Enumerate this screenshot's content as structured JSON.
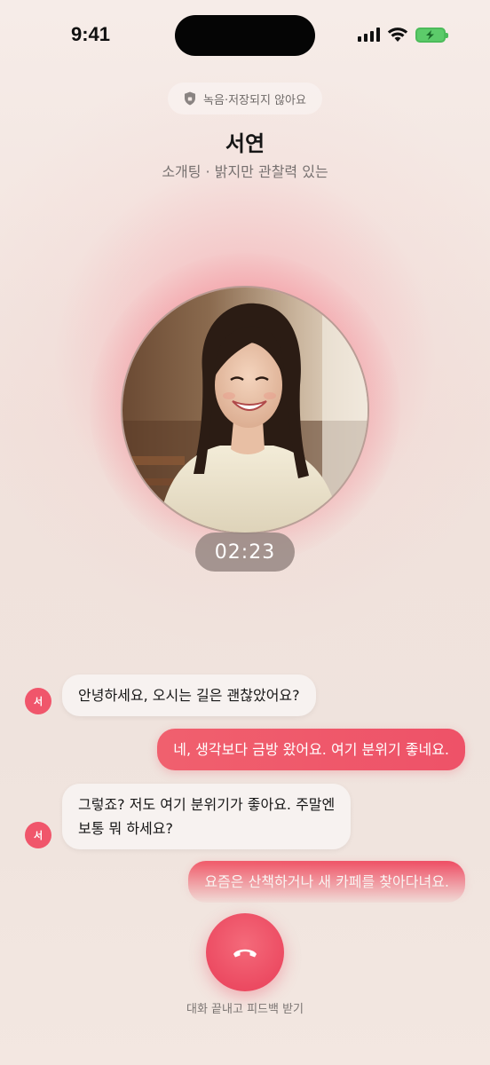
{
  "status_bar": {
    "time": "9:41"
  },
  "header": {
    "privacy_notice": "녹음·저장되지 않아요",
    "contact_name": "서연",
    "contact_subtitle": "소개팅 · 밝지만 관찰력 있는"
  },
  "call": {
    "timer": "02:23"
  },
  "messages": [
    {
      "sender": "her",
      "badge": "서",
      "text_lines": [
        "안녕하세요, 오시는 길은 괜찮았어요?"
      ]
    },
    {
      "sender": "me",
      "text_lines": [
        "네, 생각보다 금방 왔어요. 여기 분위기 좋네요."
      ]
    },
    {
      "sender": "her",
      "badge": "서",
      "text_lines": [
        "그렇죠? 저도 여기 분위기가 좋아요. 주말엔",
        "보통 뭐 하세요?"
      ]
    },
    {
      "sender": "me",
      "text_lines": [
        "요즘은 산책하거나 새 카페를 찾아다녀요."
      ]
    }
  ],
  "footer": {
    "end_call_label": "대화 끝내고 피드백 받기"
  },
  "colors": {
    "accent": "#EE5268",
    "incoming_bubble": "#F7F2F0",
    "background": "#F3E6E0"
  },
  "icons": {
    "privacy": "shield-icon",
    "end_call": "phone-hangup-icon"
  }
}
